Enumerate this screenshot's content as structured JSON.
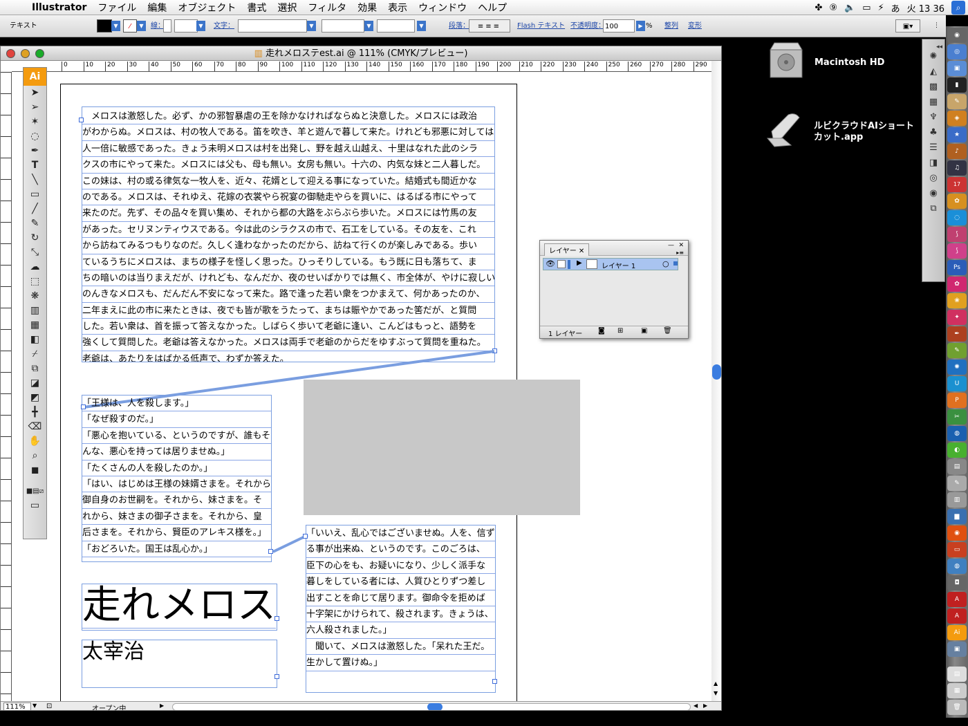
{
  "menubar": {
    "app_name": "Illustrator",
    "items": [
      "ファイル",
      "編集",
      "オブジェクト",
      "書式",
      "選択",
      "フィルタ",
      "効果",
      "表示",
      "ウィンドウ",
      "ヘルプ"
    ],
    "clock": "火 13 36"
  },
  "control": {
    "mode_label": "テキスト",
    "stroke_label": "線：",
    "char_label": "文字：",
    "para_label": "段落：",
    "flash_label": "Flash テキスト",
    "opacity_label": "不透明度：",
    "opacity_value": "100",
    "opacity_unit": "%",
    "align_label": "整列",
    "transform_label": "変形"
  },
  "document": {
    "title": "走れメロステest.ai @ 111% (CMYK/プレビュー)",
    "zoom": "111%",
    "status": "オープン中",
    "ruler_marks": [
      "0",
      "10",
      "20",
      "30",
      "40",
      "50",
      "60",
      "70",
      "80",
      "90",
      "100",
      "110",
      "120",
      "130",
      "140",
      "150",
      "160",
      "170",
      "180",
      "190",
      "200",
      "210",
      "220",
      "230",
      "240",
      "250",
      "260",
      "270",
      "280",
      "290"
    ]
  },
  "text_frames": {
    "main": [
      "　メロスは激怒した。必ず、かの邪智暴虐の王を除かなければならぬと決意した。メロスには政治",
      "がわからぬ。メロスは、村の牧人である。笛を吹き、羊と遊んで暮して来た。けれども邪悪に対しては、",
      "人一倍に敏感であった。きょう未明メロスは村を出発し、野を越え山越え、十里はなれた此のシラ",
      "クスの市にやって来た。メロスには父も、母も無い。女房も無い。十六の、内気な妹と二人暮しだ。",
      "この妹は、村の或る律気な一牧人を、近々、花婿として迎える事になっていた。結婚式も間近かな",
      "のである。メロスは、それゆえ、花嫁の衣裳やら祝宴の御馳走やらを買いに、はるばる市にやって",
      "来たのだ。先ず、その品々を買い集め、それから都の大路をぶらぶら歩いた。メロスには竹馬の友",
      "があった。セリヌンティウスである。今は此のシラクスの市で、石工をしている。その友を、これ",
      "から訪ねてみるつもりなのだ。久しく逢わなかったのだから、訪ねて行くのが楽しみである。歩い",
      "ているうちにメロスは、まちの様子を怪しく思った。ひっそりしている。もう既に日も落ちて、ま",
      "ちの暗いのは当りまえだが、けれども、なんだか、夜のせいばかりでは無く、市全体が、やけに寂しい。",
      "のんきなメロスも、だんだん不安になって来た。路で逢った若い衆をつかまえて、何かあったのか、",
      "二年まえに此の市に来たときは、夜でも皆が歌をうたって、まちは賑やかであった筈だが、と質問",
      "した。若い衆は、首を振って答えなかった。しばらく歩いて老爺に逢い、こんどはもっと、語勢を",
      "強くして質問した。老爺は答えなかった。メロスは両手で老爺のからだをゆすぶって質問を重ねた。",
      "老爺は、あたりをはばかる低声で、わずか答えた。"
    ],
    "left": [
      "「王様は、人を殺します。」",
      "「なぜ殺すのだ。」",
      "「悪心を抱いている、というのですが、誰もそ",
      "んな、悪心を持っては居りませぬ。」",
      "「たくさんの人を殺したのか。」",
      "「はい、はじめは王様の妹婿さまを。それから、",
      "御自身のお世嗣を。それから、妹さまを。そ",
      "れから、妹さまの御子さまを。それから、皇",
      "后さまを。それから、賢臣のアレキス様を。」",
      "「おどろいた。国王は乱心か。」"
    ],
    "right": [
      "「いいえ、乱心ではございませぬ。人を、信ず",
      "る事が出来ぬ、というのです。このごろは、",
      "臣下の心をも、お疑いになり、少しく派手な",
      "暮しをしている者には、人質ひとりずつ差し",
      "出すことを命じて居ります。御命令を拒めば",
      "十字架にかけられて、殺されます。きょうは、",
      "六人殺されました。」",
      "　聞いて、メロスは激怒した。「呆れた王だ。",
      "生かして置けぬ。」"
    ],
    "headline": "走れメロス",
    "author": "太宰治"
  },
  "layers_panel": {
    "tab_label": "レイヤー",
    "layer_name": "レイヤー 1",
    "count_label": "1 レイヤー"
  },
  "desktop": {
    "hd_label": "Macintosh HD",
    "app_label_line1": "ルビクラウドAIショート",
    "app_label_line2": "カット.app"
  },
  "colors": {
    "accent": "#3b74c9",
    "selection": "#7a9ee0",
    "ai_orange": "#f49b0f",
    "placeholder_gray": "#c8c8c8"
  }
}
